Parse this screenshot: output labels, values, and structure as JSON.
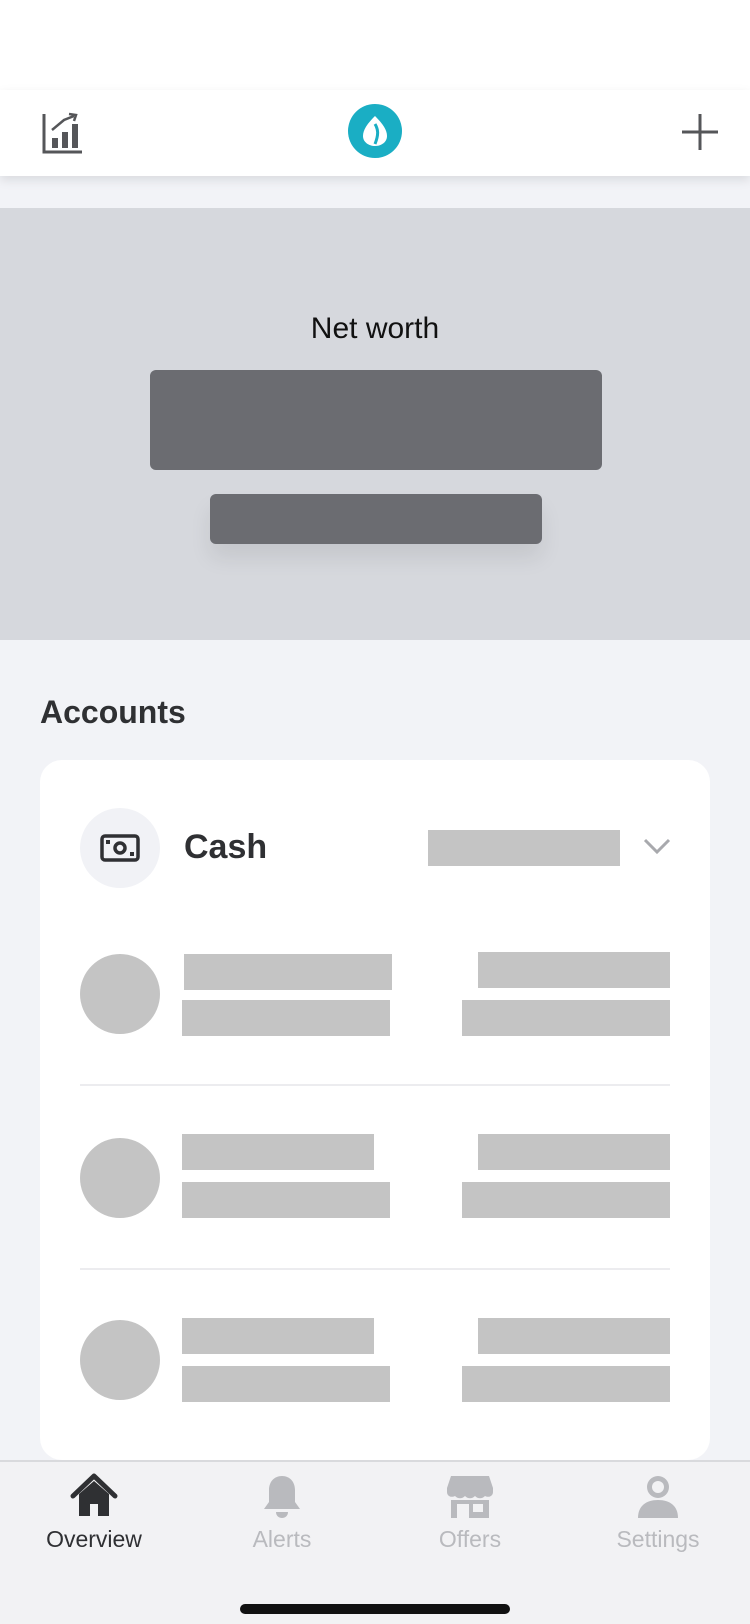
{
  "header": {
    "left_icon": "chart-bar-icon",
    "logo_icon": "droplet-leaf-icon",
    "right_icon": "plus-icon",
    "brand_color": "#1aaec4"
  },
  "net_worth": {
    "title": "Net worth"
  },
  "accounts": {
    "heading": "Accounts",
    "group": {
      "label": "Cash",
      "icon": "cash-bill-icon",
      "toggle_icon": "chevron-down-icon"
    }
  },
  "tabs": [
    {
      "label": "Overview",
      "icon": "home-icon",
      "active": true
    },
    {
      "label": "Alerts",
      "icon": "bell-icon",
      "active": false
    },
    {
      "label": "Offers",
      "icon": "store-icon",
      "active": false
    },
    {
      "label": "Settings",
      "icon": "user-icon",
      "active": false
    }
  ],
  "colors": {
    "panel_bg": "#d6d8dd",
    "placeholder_dark": "#6b6c71",
    "placeholder_light": "#c4c4c4",
    "text_dark": "#2f3033",
    "tab_inactive": "#b9babe"
  }
}
